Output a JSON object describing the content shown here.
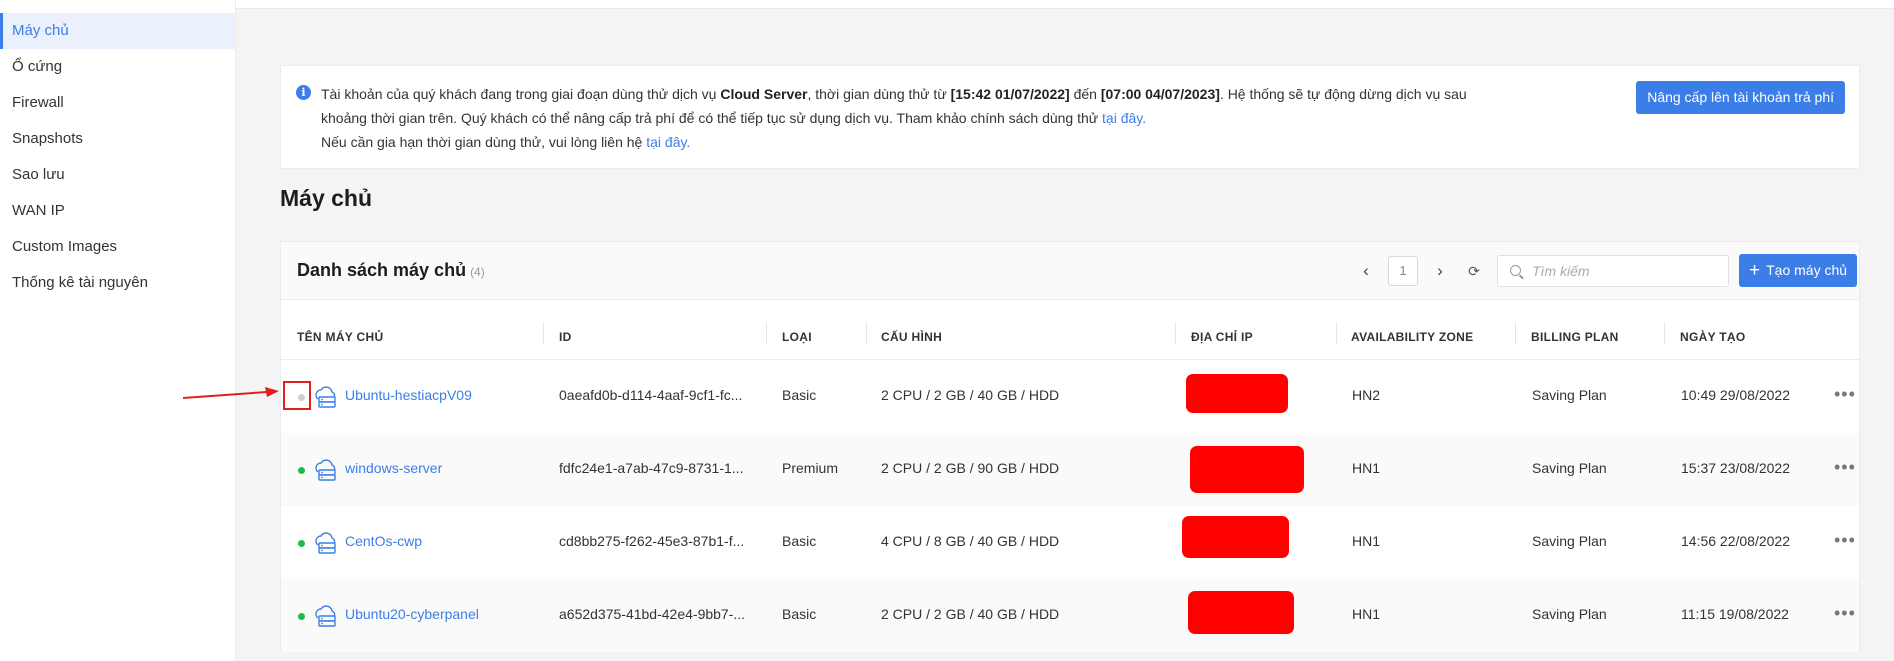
{
  "sidebar": {
    "items": [
      {
        "label": "Máy chủ",
        "active": true
      },
      {
        "label": "Ổ cứng"
      },
      {
        "label": "Firewall"
      },
      {
        "label": "Snapshots"
      },
      {
        "label": "Sao lưu"
      },
      {
        "label": "WAN IP"
      },
      {
        "label": "Custom Images"
      },
      {
        "label": "Thống kê tài nguyên"
      }
    ]
  },
  "notice": {
    "t1": "Tài khoản của quý khách đang trong giai đoạn dùng thử dịch vụ ",
    "service": "Cloud Server",
    "t2": ", thời gian dùng thử từ ",
    "start": "[15:42 01/07/2022]",
    "t3": " đến ",
    "end": "[07:00 04/07/2023]",
    "t4": ". Hệ thống sẽ tự động dừng dịch vụ sau khoảng thời gian trên. Quý khách có thể nâng cấp trả phí để có thể tiếp tục sử dụng dịch vụ. Tham khảo chính sách dùng thử ",
    "link1": "tại đây.",
    "t5": "Nếu cần gia hạn thời gian dùng thử, vui lòng liên hệ ",
    "link2": "tại đây.",
    "upgrade_label": "Nâng cấp lên tài khoản trả phí"
  },
  "page_title": "Máy chủ",
  "panel": {
    "title": "Danh sách máy chủ",
    "count": "(4)",
    "page": "1",
    "search_placeholder": "Tìm kiếm",
    "create_label": "Tạo máy chủ",
    "columns": [
      "TÊN MÁY CHỦ",
      "ID",
      "LOẠI",
      "CẤU HÌNH",
      "ĐỊA CHỈ IP",
      "AVAILABILITY ZONE",
      "BILLING PLAN",
      "NGÀY TẠO"
    ],
    "rows": [
      {
        "name": "Ubuntu-hestiacpV09",
        "id": "0aeafd0b-d114-4aaf-9cf1-fc...",
        "type": "Basic",
        "config": "2 CPU / 2 GB / 40 GB / HDD",
        "zone": "HN2",
        "plan": "Saving Plan",
        "created": "10:49 29/08/2022",
        "status": "stopped"
      },
      {
        "name": "windows-server",
        "id": "fdfc24e1-a7ab-47c9-8731-1...",
        "type": "Premium",
        "config": "2 CPU / 2 GB / 90 GB / HDD",
        "zone": "HN1",
        "plan": "Saving Plan",
        "created": "15:37 23/08/2022",
        "status": "running"
      },
      {
        "name": "CentOs-cwp",
        "id": "cd8bb275-f262-45e3-87b1-f...",
        "type": "Basic",
        "config": "4 CPU / 8 GB / 40 GB / HDD",
        "zone": "HN1",
        "plan": "Saving Plan",
        "created": "14:56 22/08/2022",
        "status": "running"
      },
      {
        "name": "Ubuntu20-cyberpanel",
        "id": "a652d375-41bd-42e4-9bb7-...",
        "type": "Basic",
        "config": "2 CPU / 2 GB / 40 GB / HDD",
        "zone": "HN1",
        "plan": "Saving Plan",
        "created": "11:15 19/08/2022",
        "status": "running"
      }
    ]
  },
  "colors": {
    "accent": "#3b7ee8",
    "running": "#22b84c",
    "stopped": "#cfcfcf",
    "redaction": "#ff0000",
    "annotation": "#e02020"
  },
  "icons": {
    "info": "info-icon",
    "search": "search-icon",
    "refresh": "refresh-icon",
    "server": "cloud-server-icon",
    "more": "more-icon",
    "plus": "plus-icon"
  }
}
